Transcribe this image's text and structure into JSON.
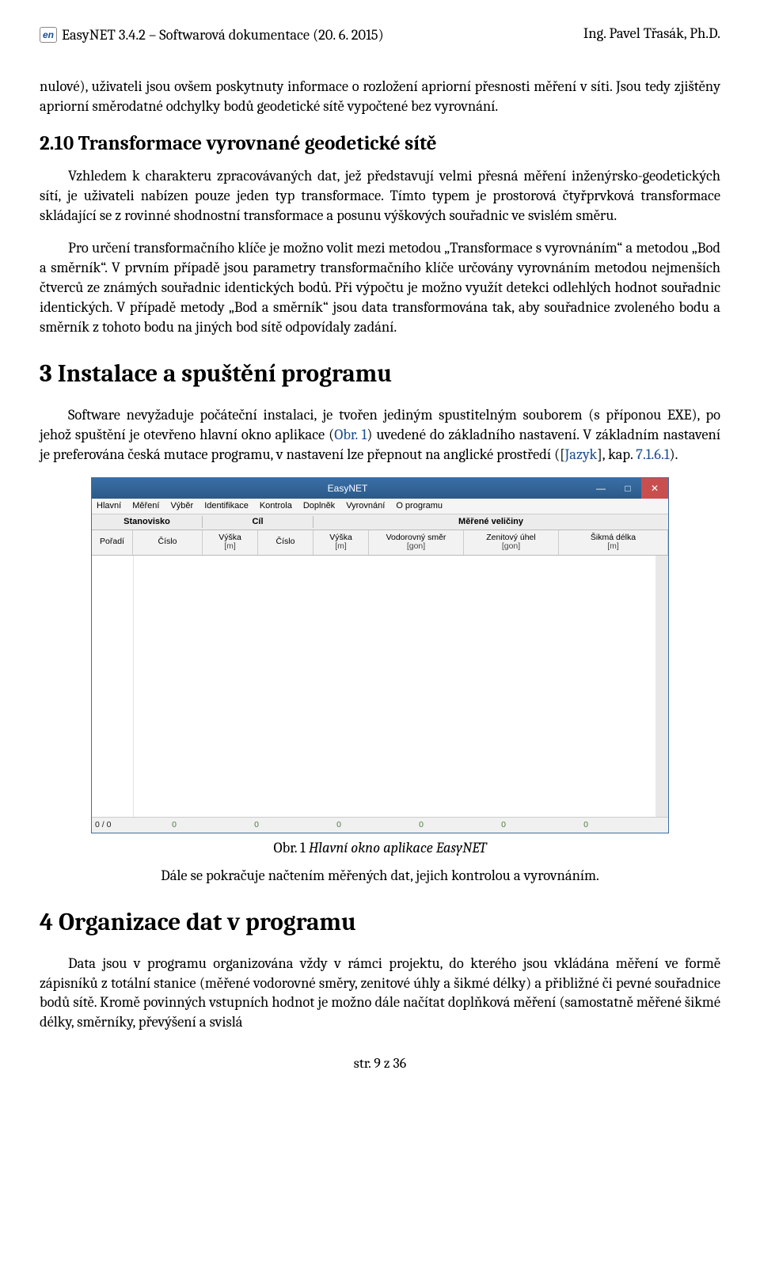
{
  "header": {
    "logo_text": "en",
    "left": "EasyNET 3.4.2 – Softwarová dokumentace (20. 6. 2015)",
    "right": "Ing. Pavel Třasák, Ph.D."
  },
  "paragraphs": {
    "p0": "nulové), uživateli jsou ovšem poskytnuty informace o rozložení apriorní přesnosti měření v síti. Jsou tedy zjištěny apriorní směrodatné odchylky bodů geodetické sítě vypočtené bez vyrovnání.",
    "h2_10": "2.10  Transformace vyrovnané geodetické sítě",
    "p1": "Vzhledem k charakteru zpracovávaných dat, jež představují velmi přesná měření inženýrsko-geodetických sítí, je uživateli nabízen pouze jeden typ transformace. Tímto typem je prostorová čtyřprvková transformace skládající se z rovinné shodnostní transformace a posunu výškových souřadnic ve svislém směru.",
    "p2": "Pro určení transformačního klíče je možno volit mezi metodou „Transformace s vyrovnáním“ a metodou „Bod a směrník“. V prvním případě jsou parametry transformačního klíče určovány vyrovnáním metodou nejmenších čtverců ze známých souřadnic identických bodů. Při výpočtu je možno využít detekci odlehlých hodnot souřadnic identických. V případě metody „Bod a směrník“ jsou data transformována tak, aby souřadnice zvoleného bodu a směrník z tohoto bodu na jiných bod sítě odpovídaly zadání.",
    "h1_3": "3    Instalace a spuštění programu",
    "p3a": "Software nevyžaduje počáteční instalaci, je tvořen jediným spustitelným souborem (s příponou EXE), po jehož spuštění je otevřeno hlavní okno aplikace (",
    "p3_link1": "Obr. 1",
    "p3b": ") uvedené do základního nastavení. V základním nastavení je preferována česká mutace programu, v nastavení lze přepnout na anglické prostředí ([",
    "p3_link2": "Jazyk",
    "p3c": "], kap. ",
    "p3_link3": "7.1.6.1",
    "p3d": ").",
    "caption_a": "Obr. 1 ",
    "caption_b": "Hlavní okno aplikace EasyNET",
    "p4": "Dále se pokračuje načtením měřených dat, jejich kontrolou a vyrovnáním.",
    "h1_4": "4    Organizace dat v programu",
    "p5": "Data jsou v programu organizována vždy v rámci projektu, do kterého jsou vkládána měření ve formě zápisníků z totální stanice (měřené vodorovné směry, zenitové úhly a šikmé délky) a přibližné či pevné souřadnice bodů sítě. Kromě povinných vstupních hodnot je možno dále načítat doplňková měření (samostatně měřené šikmé délky, směrníky, převýšení a svislá"
  },
  "window": {
    "title": "EasyNET",
    "menu": [
      "Hlavní",
      "Měření",
      "Výběr",
      "Identifikace",
      "Kontrola",
      "Doplněk",
      "Vyrovnání",
      "O programu"
    ],
    "group_headers": [
      "Stanovisko",
      "Cíl",
      "Měřené veličiny"
    ],
    "cols": [
      {
        "label": "Pořadí",
        "unit": ""
      },
      {
        "label": "Číslo",
        "unit": ""
      },
      {
        "label": "Výška",
        "unit": "[m]"
      },
      {
        "label": "Číslo",
        "unit": ""
      },
      {
        "label": "Výška",
        "unit": "[m]"
      },
      {
        "label": "Vodorovný směr",
        "unit": "[gon]"
      },
      {
        "label": "Zenitový úhel",
        "unit": "[gon]"
      },
      {
        "label": "Šikmá délka",
        "unit": "[m]"
      }
    ],
    "status": {
      "first": "0 / 0",
      "zeros": [
        "0",
        "0",
        "0",
        "0",
        "0",
        "0"
      ]
    }
  },
  "footer": "str. 9 z 36"
}
